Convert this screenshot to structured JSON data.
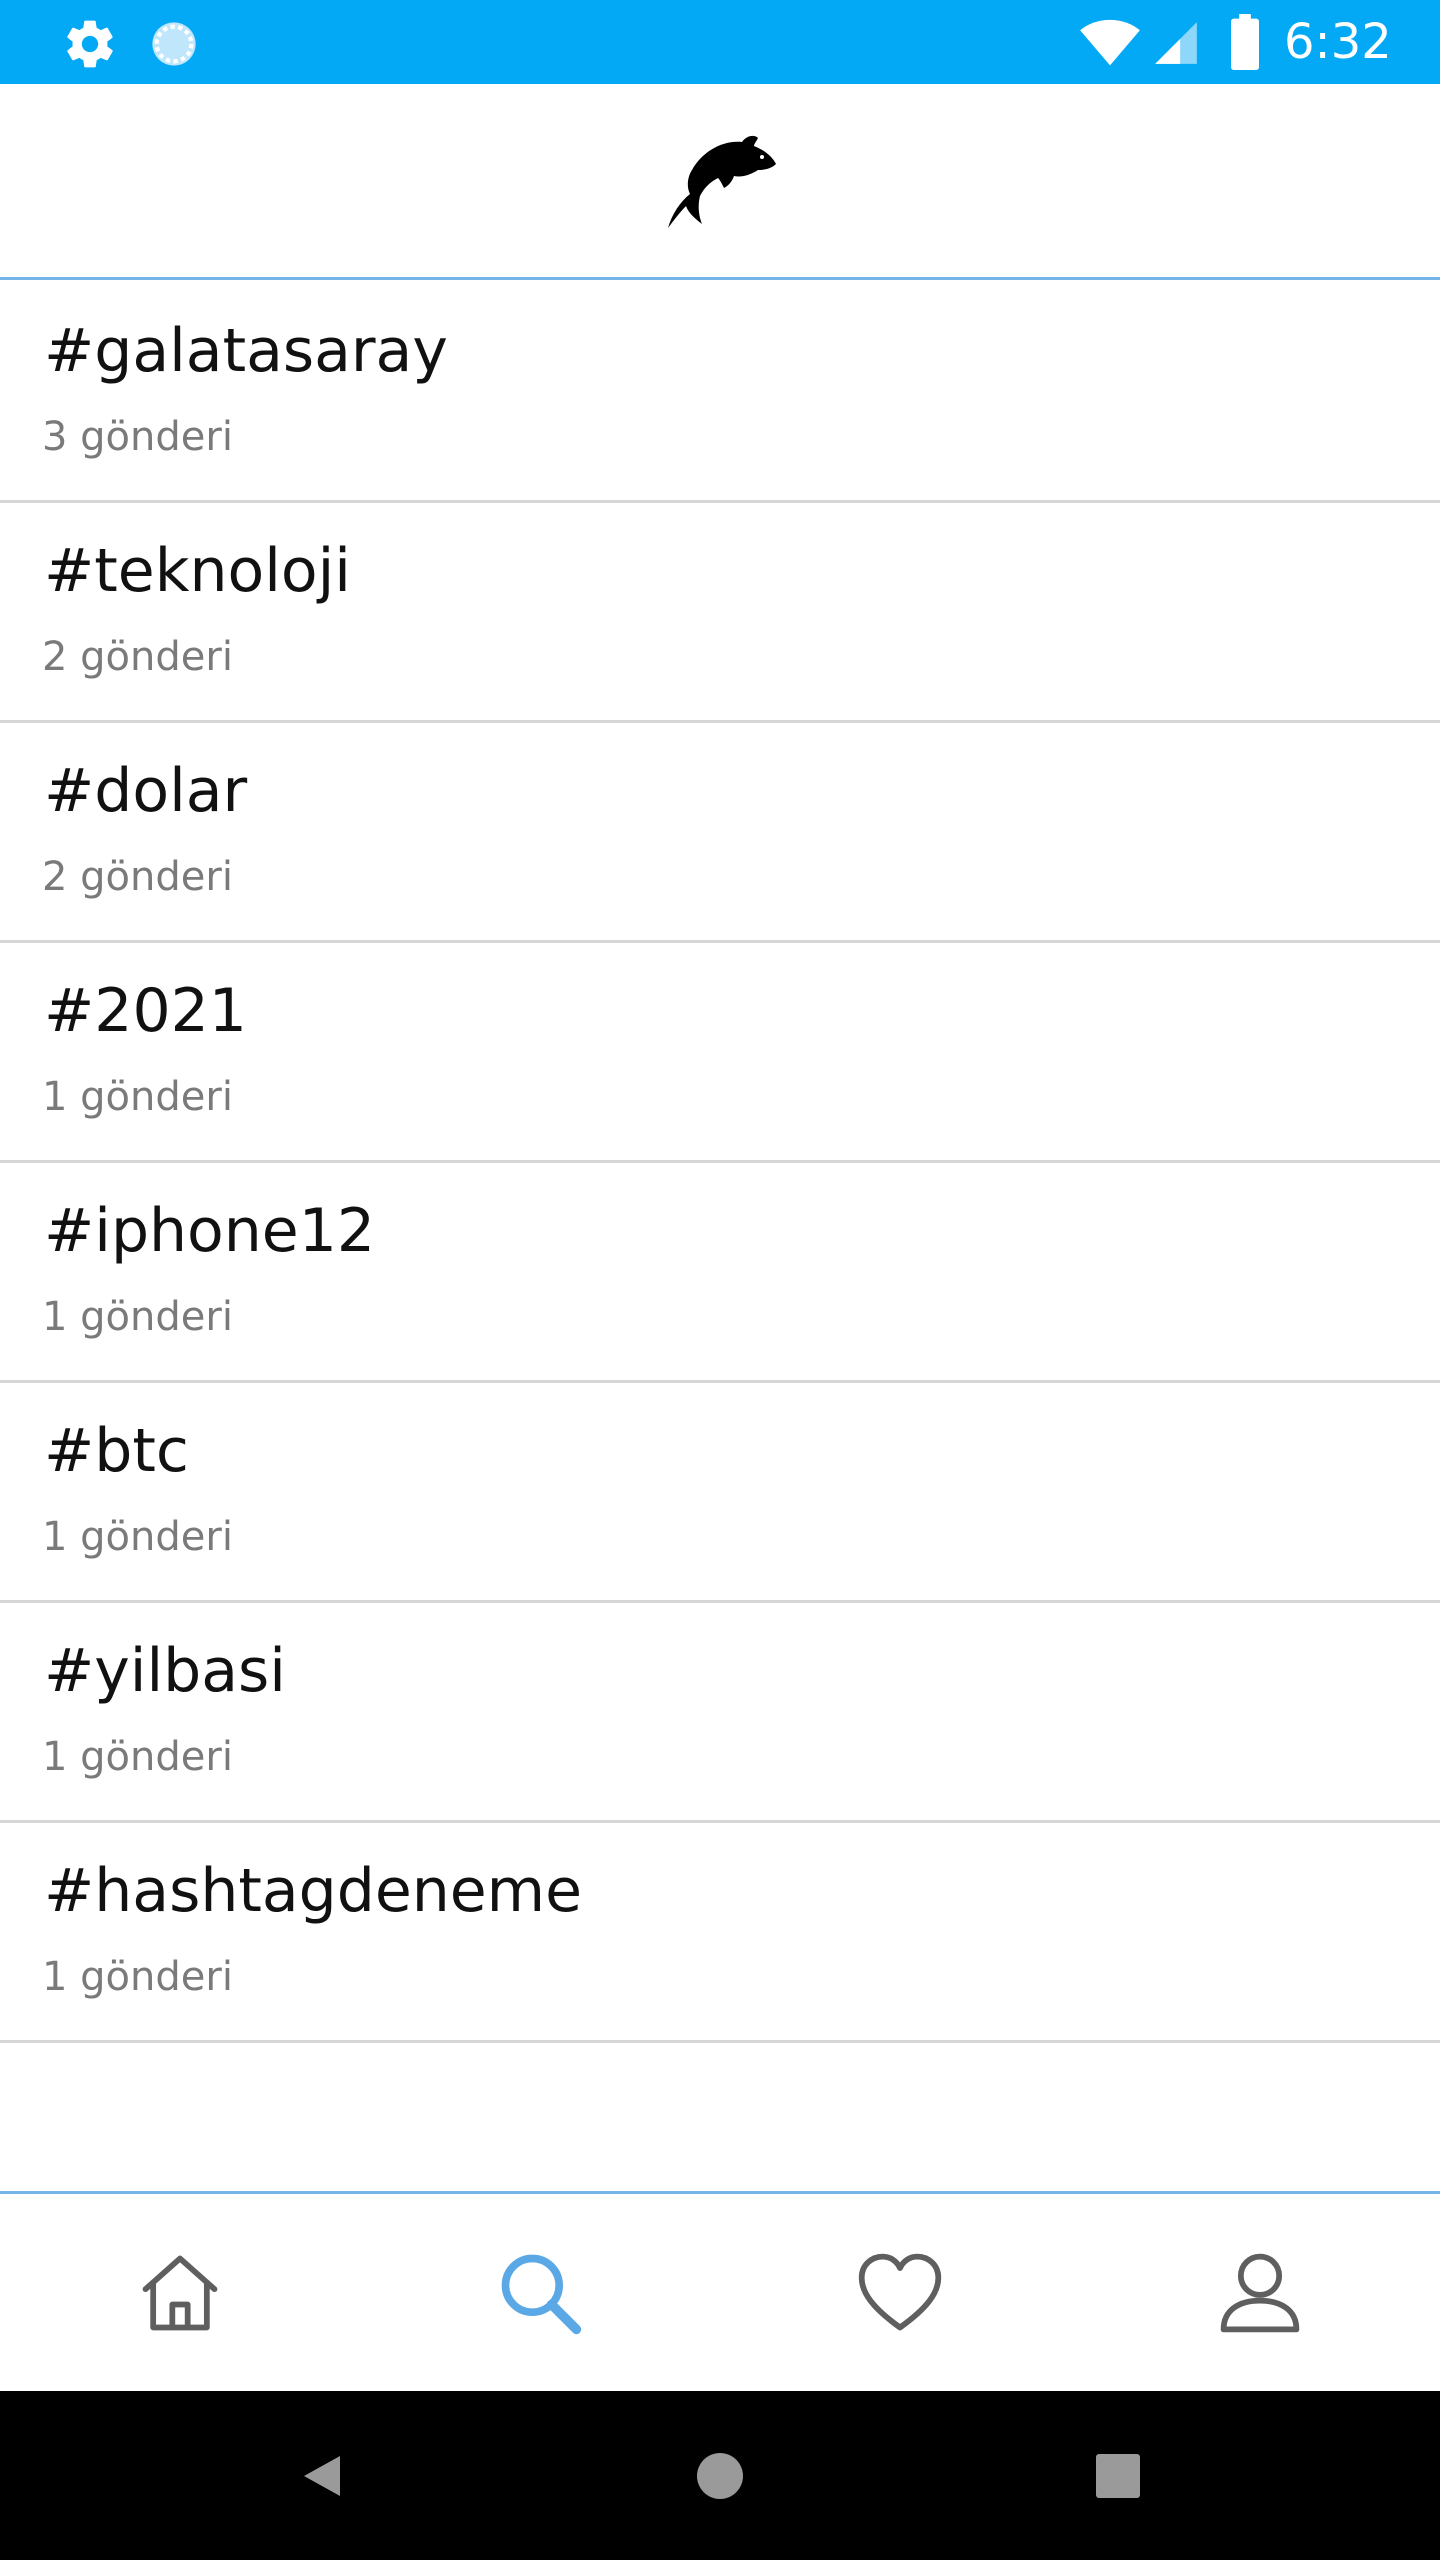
{
  "status_bar": {
    "time": "6:32",
    "background_color": "#03a9f4",
    "icons": [
      "gear-icon",
      "loading-icon",
      "wifi-icon",
      "signal-icon",
      "battery-icon"
    ]
  },
  "header": {
    "logo": "dolphin-logo-icon",
    "divider_color": "#74b4e6"
  },
  "hashtags": [
    {
      "tag": "#galatasaray",
      "count": "3 gönderi"
    },
    {
      "tag": "#teknoloji",
      "count": "2 gönderi"
    },
    {
      "tag": "#dolar",
      "count": "2 gönderi"
    },
    {
      "tag": "#2021",
      "count": "1 gönderi"
    },
    {
      "tag": "#iphone12",
      "count": "1 gönderi"
    },
    {
      "tag": "#btc",
      "count": "1 gönderi"
    },
    {
      "tag": "#yilbasi",
      "count": "1 gönderi"
    },
    {
      "tag": "#hashtagdeneme",
      "count": "1 gönderi"
    }
  ],
  "bottom_nav": {
    "items": [
      {
        "icon": "home-icon",
        "active": false
      },
      {
        "icon": "search-icon",
        "active": true
      },
      {
        "icon": "heart-icon",
        "active": false
      },
      {
        "icon": "user-icon",
        "active": false
      }
    ],
    "active_color": "#5aa9e6",
    "inactive_color": "#5f5f5f"
  },
  "system_nav": {
    "icons": [
      "back-icon",
      "home-circle-icon",
      "recents-icon"
    ]
  }
}
